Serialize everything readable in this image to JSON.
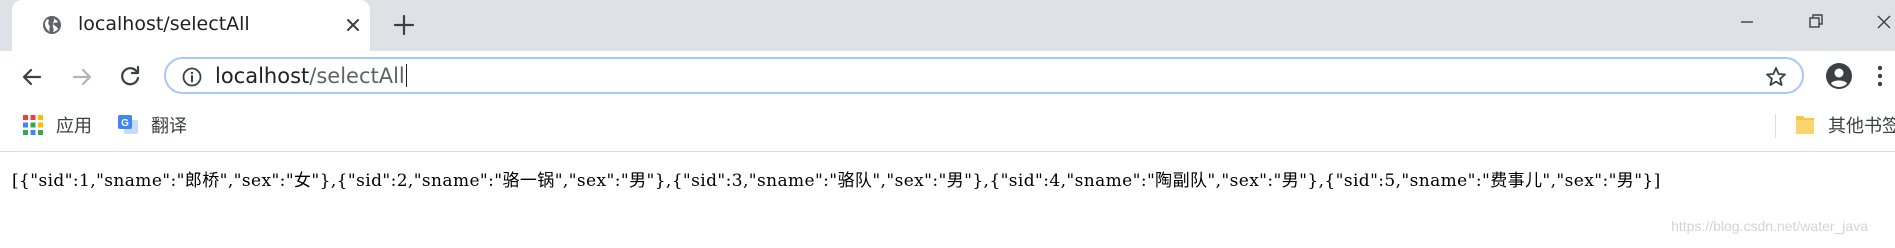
{
  "tab": {
    "title": "localhost/selectAll",
    "favicon": "globe-icon",
    "close": "close-icon"
  },
  "toolbar": {
    "new_tab": "plus-icon",
    "back": "arrow-left-icon",
    "forward": "arrow-right-icon",
    "reload": "reload-icon",
    "info": "info-icon",
    "bookmark_star": "star-icon",
    "profile": "account-icon",
    "menu": "more-vertical-icon"
  },
  "omnibox": {
    "url_host": "localhost",
    "url_path": "/selectAll"
  },
  "bookmarks": {
    "apps": {
      "label": "应用",
      "icon": "apps-grid-icon"
    },
    "translate": {
      "label": "翻译",
      "icon": "translate-icon"
    },
    "other": {
      "label": "其他书签",
      "icon": "folder-icon"
    }
  },
  "page": {
    "json_response": "[{\"sid\":1,\"sname\":\"郎桥\",\"sex\":\"女\"},{\"sid\":2,\"sname\":\"骆一锅\",\"sex\":\"男\"},{\"sid\":3,\"sname\":\"骆队\",\"sex\":\"男\"},{\"sid\":4,\"sname\":\"陶副队\",\"sex\":\"男\"},{\"sid\":5,\"sname\":\"费事儿\",\"sex\":\"男\"}]",
    "watermark": "https://blog.csdn.net/water_java"
  },
  "colors": {
    "tabstrip": "#dee1e6",
    "omnibox_border": "#a8c7fa",
    "icon": "#5f6368"
  }
}
